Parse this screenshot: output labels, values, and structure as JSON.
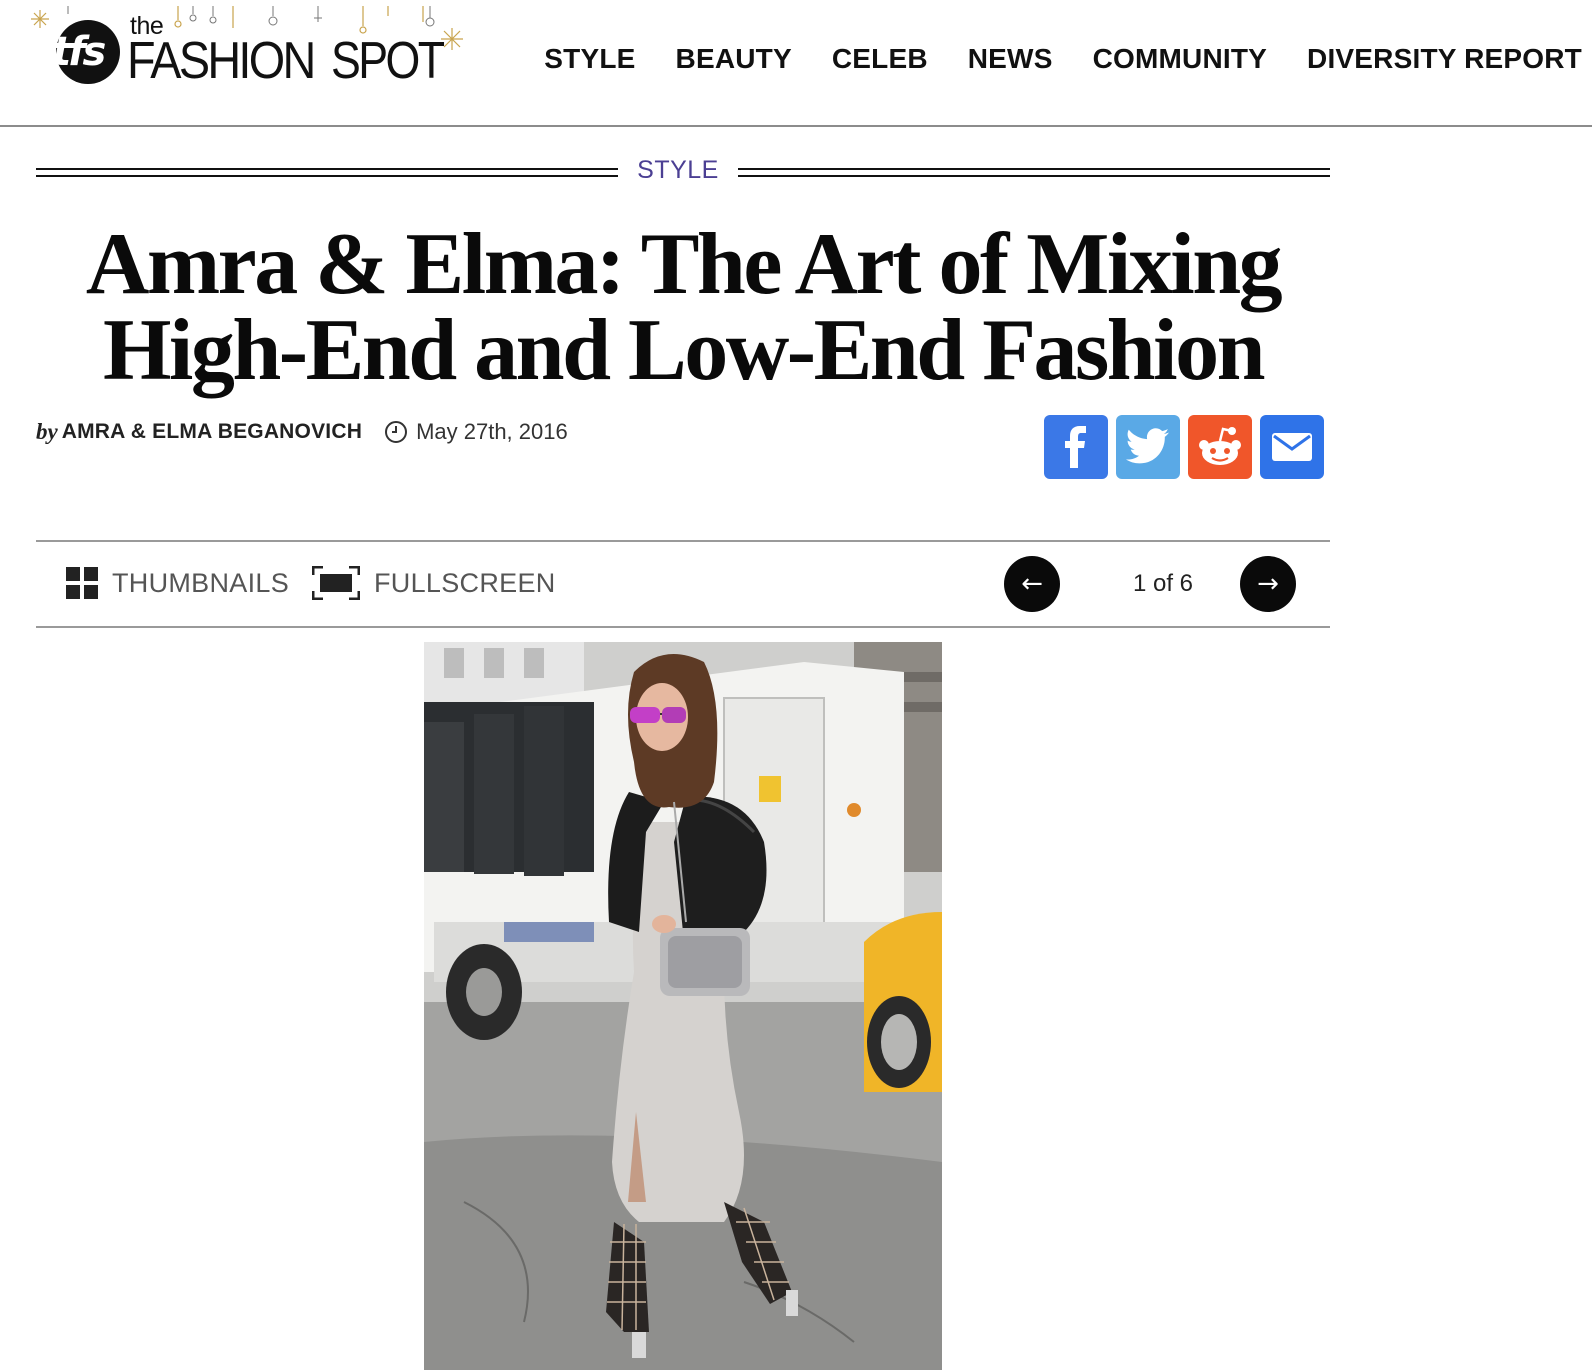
{
  "site": {
    "logo_prefix": "the",
    "logo_main": "FASHION",
    "logo_suffix": "SPOT",
    "logo_badge": "tfs"
  },
  "nav": {
    "items": [
      {
        "label": "STYLE"
      },
      {
        "label": "BEAUTY"
      },
      {
        "label": "CELEB"
      },
      {
        "label": "NEWS"
      },
      {
        "label": "COMMUNITY"
      },
      {
        "label": "DIVERSITY REPORT"
      }
    ]
  },
  "article": {
    "section": "STYLE",
    "title_line1": "Amra & Elma: The Art of Mixing",
    "title_line2": "High-End and Low-End Fashion",
    "by_prefix": "by",
    "author": "AMRA & ELMA BEGANOVICH",
    "date": "May 27th, 2016"
  },
  "share": {
    "buttons": [
      {
        "icon": "facebook-icon",
        "color": "#3b78e7"
      },
      {
        "icon": "twitter-icon",
        "color": "#5aa9e6"
      },
      {
        "icon": "reddit-icon",
        "color": "#f0562a"
      },
      {
        "icon": "email-icon",
        "color": "#2f73e8"
      }
    ]
  },
  "gallery": {
    "thumbnails_label": "THUMBNAILS",
    "fullscreen_label": "FULLSCREEN",
    "prev_glyph": "←",
    "next_glyph": "→",
    "position": "1 of 6"
  },
  "colors": {
    "section_accent": "#4b3f93",
    "text": "#111111",
    "rule": "#9a9a9a"
  }
}
